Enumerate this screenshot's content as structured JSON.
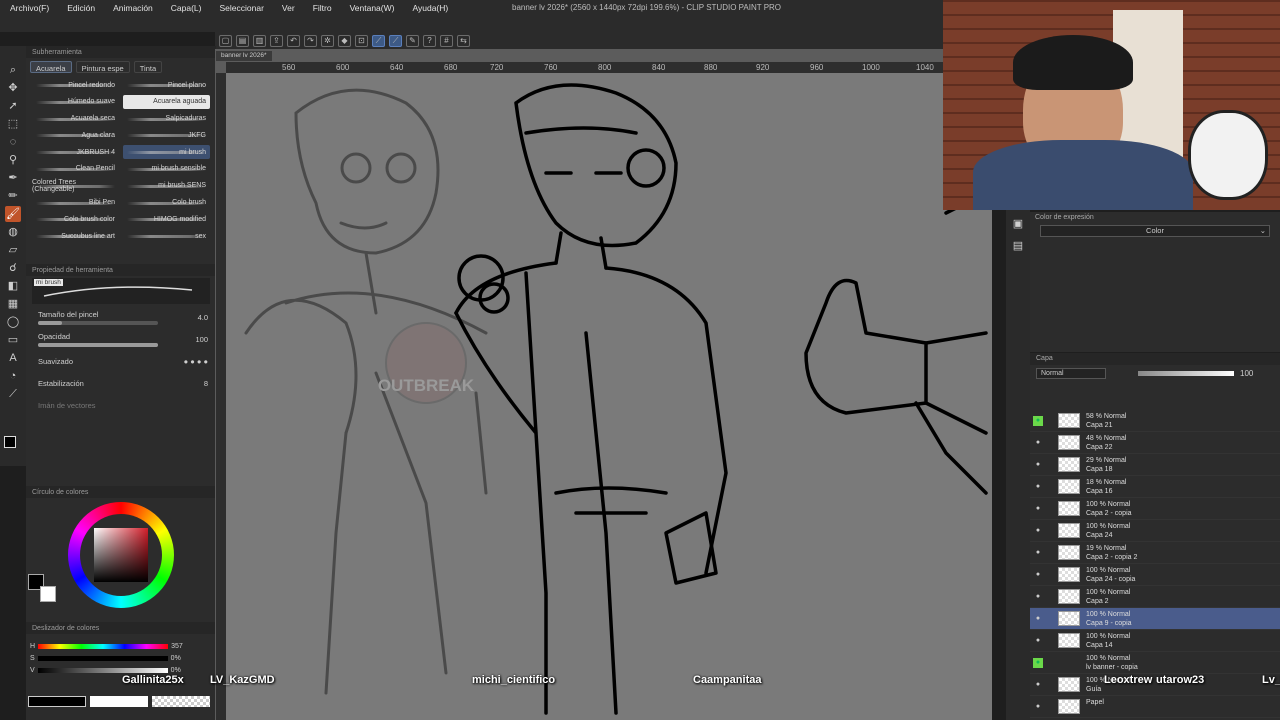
{
  "app": {
    "title": "banner lv 2026* (2560 x 1440px 72dpi 199.6%) - CLIP STUDIO PAINT PRO",
    "doc_tab": "banner lv 2026*"
  },
  "menu": [
    "Archivo(F)",
    "Edición",
    "Animación",
    "Capa(L)",
    "Seleccionar",
    "Ver",
    "Filtro",
    "Ventana(W)",
    "Ayuda(H)"
  ],
  "subtool_panel": {
    "title": "Subherramienta",
    "tabs": [
      "Acuarela",
      "Pintura espe",
      "Tinta"
    ],
    "brushes": [
      {
        "left": "Pincel redondo",
        "right": "Pincel plano"
      },
      {
        "left": "Húmedo suave",
        "right": "Acuarela aguada"
      },
      {
        "left": "Acuarela seca",
        "right": "Salpicaduras"
      },
      {
        "left": "Agua clara",
        "right": "JKFG"
      },
      {
        "left": "JKBRUSH 4",
        "right": "mi brush"
      },
      {
        "left": "Clean Pencil",
        "right": "mi brush sensible"
      },
      {
        "left": "Colored Trees (Changeable)",
        "right": "mi brush SENS"
      },
      {
        "left": "Bibi Pen",
        "right": "Colo brush"
      },
      {
        "left": "Colo brush color",
        "right": "HIMOG modified"
      },
      {
        "left": "Succubus line art",
        "right": "sex"
      }
    ]
  },
  "tool_property": {
    "title": "Propiedad de herramienta",
    "brush_name": "mi brush",
    "size_label": "Tamaño del pincel",
    "size_value": "4.0",
    "opacity_label": "Opacidad",
    "opacity_value": "100",
    "opacity_fraction": 1.0,
    "smoothing_label": "Suavizado",
    "stabilization_label": "Estabilización",
    "stabilization_value": "8",
    "vector_label": "Imán de vectores"
  },
  "color_wheel": {
    "title": "Círculo de colores"
  },
  "color_slider": {
    "title": "Deslizador de colores",
    "h": "357",
    "s": "0%",
    "v": "0%"
  },
  "ruler": [
    "560",
    "600",
    "640",
    "680",
    "720",
    "760",
    "800",
    "840",
    "880",
    "920",
    "960",
    "1000",
    "1040"
  ],
  "expression": {
    "title": "Color de expresión",
    "value": "Color"
  },
  "layers": {
    "title": "Capa",
    "blend_mode": "Normal",
    "opacity": "100",
    "items": [
      {
        "pct": "58 % Normal",
        "name": "Capa 21"
      },
      {
        "pct": "48 % Normal",
        "name": "Capa 22"
      },
      {
        "pct": "29 % Normal",
        "name": "Capa 18"
      },
      {
        "pct": "18 % Normal",
        "name": "Capa 16"
      },
      {
        "pct": "100 % Normal",
        "name": "Capa 2 - copia"
      },
      {
        "pct": "100 % Normal",
        "name": "Capa 24"
      },
      {
        "pct": "19 % Normal",
        "name": "Capa 2 - copia 2"
      },
      {
        "pct": "100 % Normal",
        "name": "Capa 24 - copia"
      },
      {
        "pct": "100 % Normal",
        "name": "Capa 2"
      },
      {
        "pct": "100 % Normal",
        "name": "Capa 9 - copia"
      },
      {
        "pct": "100 % Normal",
        "name": "Capa 14"
      },
      {
        "pct": "100 % Normal",
        "name": "lv banner - copia"
      },
      {
        "pct": "100 % Normal",
        "name": "Guía"
      },
      {
        "pct": "",
        "name": "Papel"
      }
    ]
  },
  "chat_names": [
    "Gallinita25x",
    "LV_KazGMD",
    "michi_cientifico",
    "Caampanitaa",
    "Leoxtrew",
    "utarow23",
    "Lv_I"
  ],
  "colors": {
    "accent": "#3d5a86",
    "panel": "#2c2c2c",
    "active_tool": "#c0542a"
  }
}
